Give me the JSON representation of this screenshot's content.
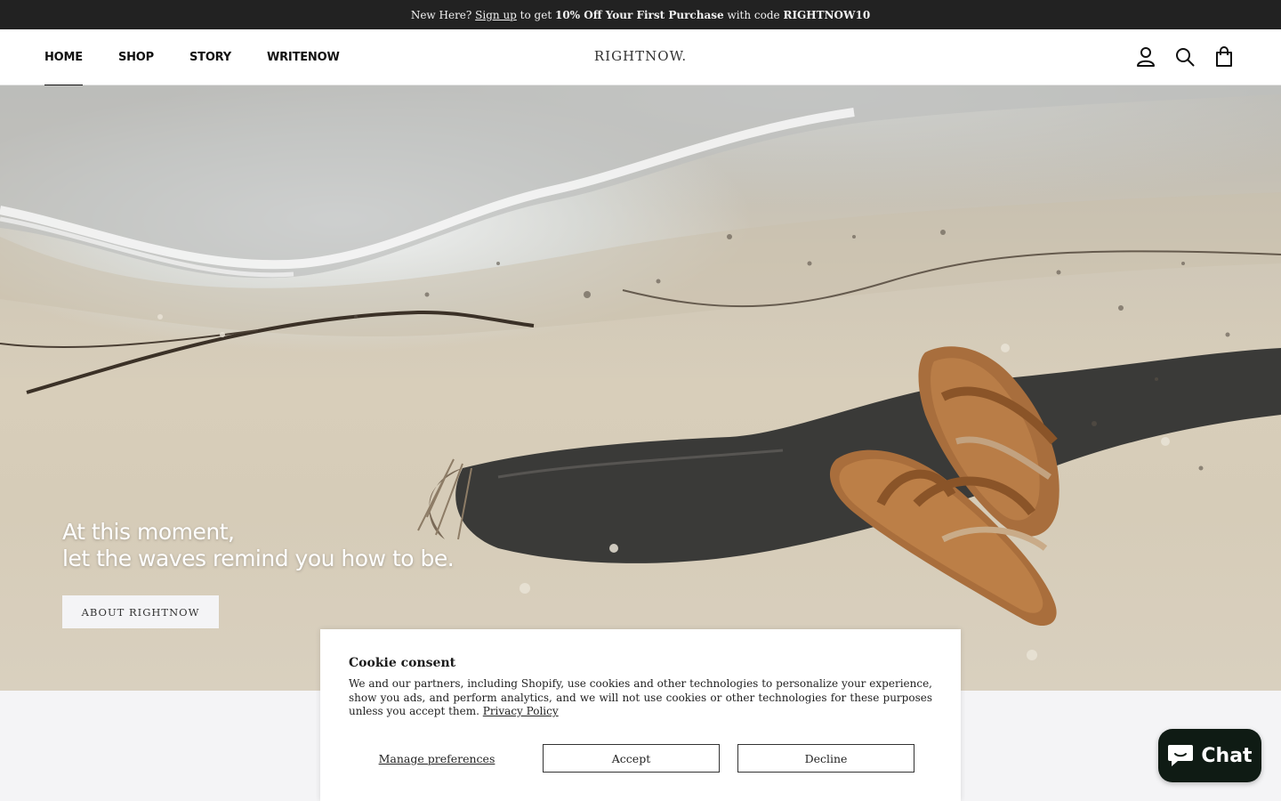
{
  "announcement": {
    "prefix": "New Here? ",
    "signup_link": "Sign up",
    "middle": " to get ",
    "offer": "10% Off Your First Purchase",
    "code_text": " with code ",
    "code": "RIGHTNOW10"
  },
  "header": {
    "nav": [
      "HOME",
      "SHOP",
      "STORY",
      "WRITENOW"
    ],
    "active_nav": "HOME",
    "logo": "RIGHTNOW.",
    "icons": [
      "account-icon",
      "search-icon",
      "cart-icon"
    ]
  },
  "hero": {
    "line1": "At this moment,",
    "line2": "let the waves remind you how to be.",
    "button": "ABOUT RIGHTNOW"
  },
  "cookie": {
    "title": "Cookie consent",
    "body": "We and our partners, including Shopify, use cookies and other technologies to personalize your experience, show you ads, and perform analytics, and we will not use cookies or other technologies for these purposes unless you accept them. ",
    "policy_link": "Privacy Policy",
    "manage": "Manage preferences",
    "accept": "Accept",
    "decline": "Decline"
  },
  "chat": {
    "label": "Chat",
    "icon": "chat-bubble-icon"
  },
  "colors": {
    "announcement_bg": "#222222",
    "chat_bg": "#0f1b14",
    "page_bg": "#f4f4f6"
  }
}
